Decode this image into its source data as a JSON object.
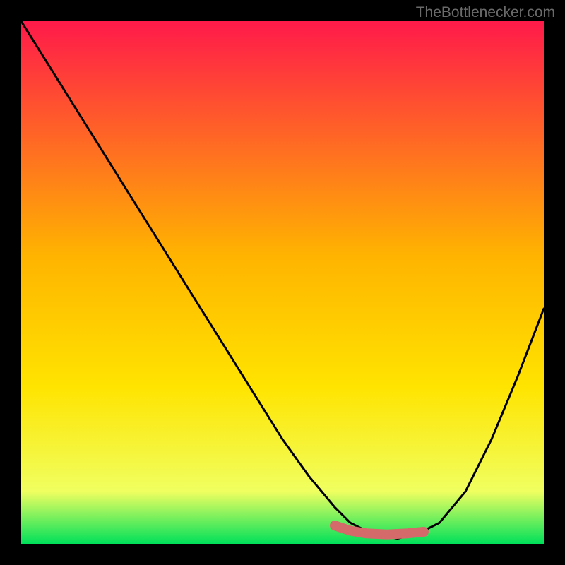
{
  "watermark": "TheBottlenecker.com",
  "chart_data": {
    "type": "line",
    "title": "",
    "xlabel": "",
    "ylabel": "",
    "xlim": [
      0,
      100
    ],
    "ylim": [
      0,
      100
    ],
    "background_gradient": {
      "top": "#ff1a4a",
      "mid": "#ffe400",
      "bottom": "#00e05a"
    },
    "series": [
      {
        "name": "bottleneck-curve",
        "color": "#000000",
        "x": [
          0,
          5,
          10,
          15,
          20,
          25,
          30,
          35,
          40,
          45,
          50,
          55,
          60,
          63,
          67,
          72,
          76,
          80,
          85,
          90,
          95,
          100
        ],
        "y": [
          100,
          92,
          84,
          76,
          68,
          60,
          52,
          44,
          36,
          28,
          20,
          13,
          7,
          4,
          2,
          1,
          2,
          4,
          10,
          20,
          32,
          45
        ]
      },
      {
        "name": "highlight-segment",
        "color": "#d46a6a",
        "thick": true,
        "x": [
          60,
          63,
          66,
          70,
          74,
          77
        ],
        "y": [
          3.5,
          2.5,
          2.0,
          1.8,
          2.0,
          2.3
        ]
      }
    ]
  }
}
